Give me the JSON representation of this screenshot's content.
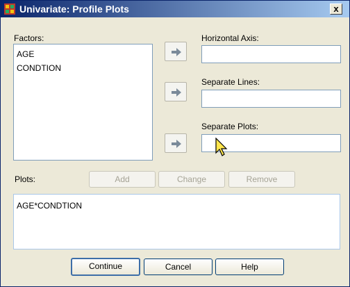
{
  "window": {
    "title": "Univariate: Profile Plots",
    "close_glyph": "x",
    "icon": "spss-grid-icon",
    "close_icon": "close-icon"
  },
  "factors": {
    "label": "Factors:",
    "items": [
      "AGE",
      "CONDTION"
    ]
  },
  "targets": {
    "horizontal_axis": {
      "label": "Horizontal Axis:",
      "value": ""
    },
    "separate_lines": {
      "label": "Separate Lines:",
      "value": ""
    },
    "separate_plots": {
      "label": "Separate Plots:",
      "value": ""
    },
    "arrow_icon": "arrow-right-icon"
  },
  "plots": {
    "label": "Plots:",
    "add_label": "Add",
    "change_label": "Change",
    "remove_label": "Remove",
    "items": [
      "AGE*CONDTION"
    ]
  },
  "footer": {
    "continue_label": "Continue",
    "cancel_label": "Cancel",
    "help_label": "Help"
  },
  "colors": {
    "title_start": "#0a246a",
    "title_end": "#a6caf0",
    "dialog_bg": "#ece9d8",
    "field_border": "#7f9db9"
  }
}
